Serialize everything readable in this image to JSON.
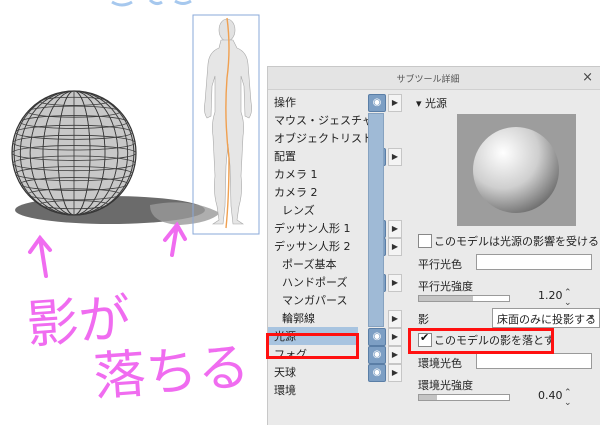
{
  "panel": {
    "title": "サブツール詳細",
    "close_label": "×",
    "categories": [
      {
        "label": "操作",
        "eye": true,
        "arrow": true
      },
      {
        "label": "マウス・ジェスチャー",
        "eye": false,
        "arrow": false
      },
      {
        "label": "オブジェクトリスト",
        "eye": false,
        "arrow": false
      },
      {
        "label": "配置",
        "eye": true,
        "arrow": true
      },
      {
        "label": "カメラ 1",
        "eye": false,
        "arrow": false
      },
      {
        "label": "カメラ 2",
        "eye": false,
        "arrow": false
      },
      {
        "label": "レンズ",
        "eye": false,
        "arrow": false
      },
      {
        "label": "デッサン人形 1",
        "eye": true,
        "arrow": true
      },
      {
        "label": "デッサン人形 2",
        "eye": true,
        "arrow": true
      },
      {
        "label": "ポーズ基本",
        "eye": false,
        "arrow": false
      },
      {
        "label": "ハンドポーズ",
        "eye": true,
        "arrow": true
      },
      {
        "label": "マンガパース",
        "eye": false,
        "arrow": false
      },
      {
        "label": "輪郭線",
        "eye": false,
        "arrow": true
      },
      {
        "label": "光源",
        "eye": true,
        "arrow": true,
        "selected": true
      },
      {
        "label": "フォグ",
        "eye": true,
        "arrow": true
      },
      {
        "label": "天球",
        "eye": true,
        "arrow": true
      },
      {
        "label": "環境",
        "eye": false,
        "arrow": false
      }
    ],
    "section_title": "光源",
    "receive_light_label": "このモデルは光源の影響を受ける",
    "parallel_light_color_label": "平行光色",
    "parallel_light_intensity_label": "平行光強度",
    "parallel_light_intensity_value": "1.20",
    "shadow_label": "影",
    "shadow_select_value": "床面のみに投影する",
    "cast_shadow_label": "このモデルの影を落とす",
    "cast_shadow_checked": true,
    "ambient_color_label": "環境光色",
    "ambient_intensity_label": "環境光強度",
    "ambient_intensity_value": "0.40",
    "parallel_light_intensity_fraction": 0.6,
    "ambient_intensity_fraction": 0.2
  },
  "annotation": {
    "handwritten_text": "影が落ちる",
    "color": "#f06cf0"
  },
  "colors": {
    "highlight_red": "#ff1010",
    "eye_blue": "#7d9fc4",
    "panel_bg": "#eaeaea"
  }
}
